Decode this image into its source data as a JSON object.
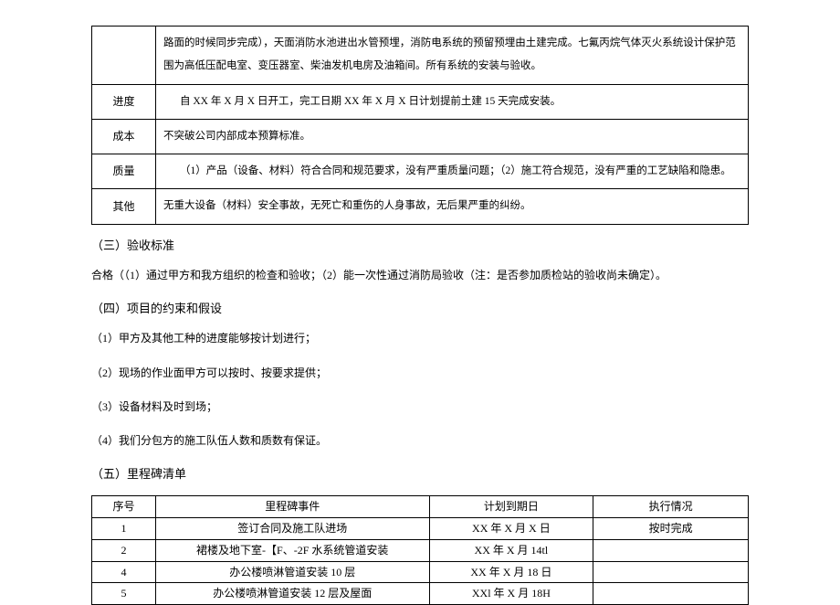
{
  "table1": {
    "row1": {
      "content": "路面的时候同步完成），天面消防水池进出水管预埋，消防电系统的预留预埋由土建完成。七氟丙烷气体灭火系统设计保护范围为高低压配电室、变压器室、柴油发机电房及油箱间。所有系统的安装与验收。"
    },
    "row2": {
      "label": "进度",
      "content": "自 XX 年 X 月 X 日开工，完工日期 XX 年 X 月 X 日计划提前土建 15 天完成安装。"
    },
    "row3": {
      "label": "成本",
      "content": "不突破公司内部成本预算标准。"
    },
    "row4": {
      "label": "质量",
      "content": "（1）产品（设备、材料）符合合同和规范要求，没有严重质量问题；（2）施工符合规范，没有严重的工艺缺陷和隐患。"
    },
    "row5": {
      "label": "其他",
      "content": "无重大设备（材料）安全事故，无死亡和重伤的人身事故，无后果严重的纠纷。"
    }
  },
  "section3": {
    "title": "（三）验收标准",
    "para": "合格（（1）通过甲方和我方组织的检查和验收；（2）能一次性通过消防局验收（注：是否参加质检站的验收尚未确定）。"
  },
  "section4": {
    "title": "（四）项目的约束和假设",
    "p1": "（1）甲方及其他工种的进度能够按计划进行；",
    "p2": "（2）现场的作业面甲方可以按时、按要求提供；",
    "p3": "（3）设备材料及时到场；",
    "p4": "（4）我们分包方的施工队伍人数和质数有保证。"
  },
  "section5": {
    "title": "（五）里程碑清单",
    "headers": {
      "seq": "序号",
      "event": "里程碑事件",
      "date": "计划到期日",
      "status": "执行情况"
    },
    "rows": [
      {
        "seq": "1",
        "event": "签订合同及施工队进场",
        "date": "XX 年 X 月 X 日",
        "status": "按时完成"
      },
      {
        "seq": "2",
        "event": "裙楼及地下室-【F、-2F 水系统管道安装",
        "date": "XX 年 X 月 14tl",
        "status": ""
      },
      {
        "seq": "4",
        "event": "办公楼喷淋管道安装 10 层",
        "date": "XX 年 X 月 18 日",
        "status": ""
      },
      {
        "seq": "5",
        "event": "办公楼喷淋管道安装 12 层及屋面",
        "date": "XXl 年 X 月 18H",
        "status": ""
      }
    ]
  }
}
